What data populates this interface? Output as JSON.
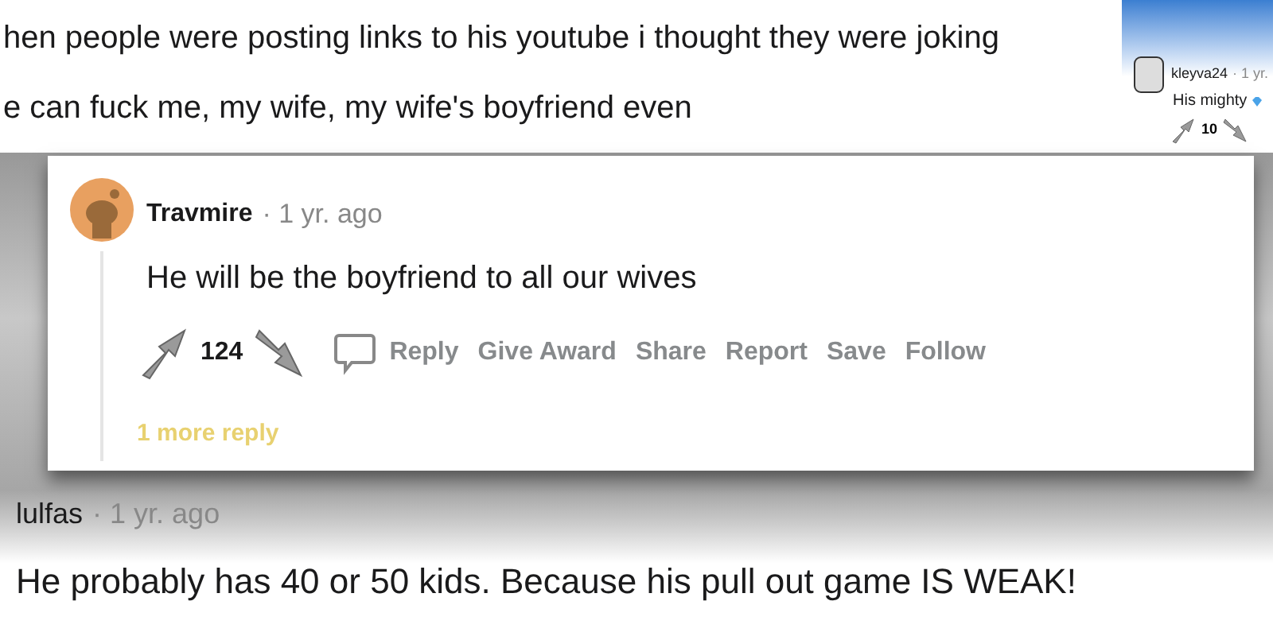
{
  "top_comment": {
    "lines": [
      "hen people were posting links to his youtube i thought they were joking",
      "e can fuck me, my wife, my wife's boyfriend even"
    ]
  },
  "side_comment": {
    "user": "kleyva24",
    "time": "· 1 yr.",
    "body": "His mighty",
    "votes": "10"
  },
  "main_comment": {
    "user": "Travmire",
    "time": "· 1 yr. ago",
    "body": "He will be the boyfriend to all our wives",
    "votes": "124",
    "actions": [
      "Reply",
      "Give Award",
      "Share",
      "Report",
      "Save",
      "Follow"
    ],
    "more": "1 more reply"
  },
  "bottom_comment": {
    "user": "lulfas",
    "time": "· 1 yr. ago",
    "body": "He probably has 40 or 50 kids. Because his pull out game IS WEAK!"
  }
}
